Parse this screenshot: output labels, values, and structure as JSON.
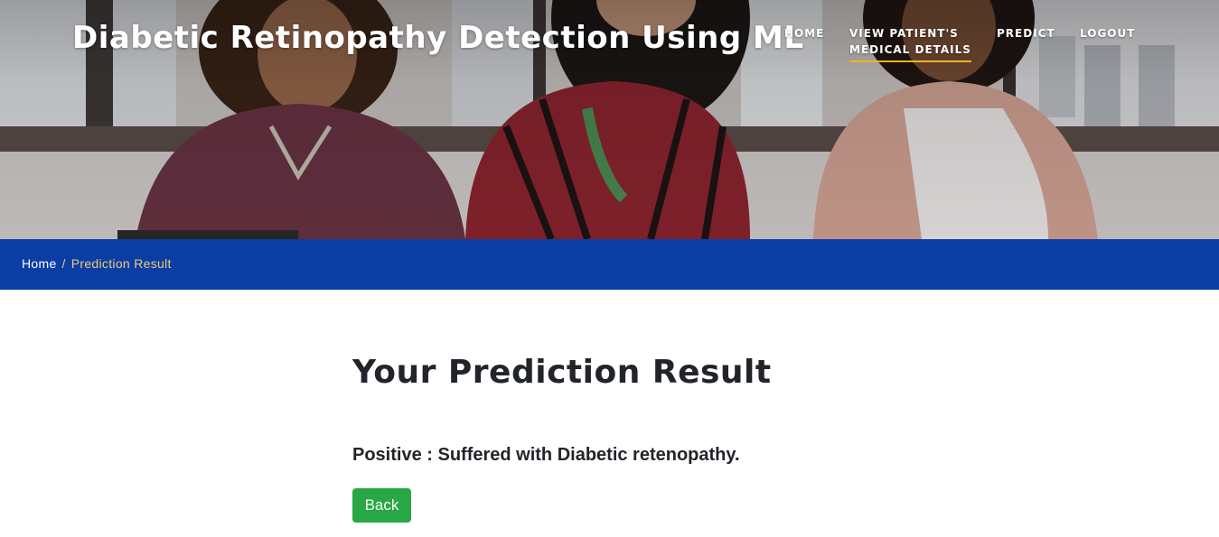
{
  "header": {
    "site_title": "Diabetic Retinopathy Detection Using ML",
    "nav": {
      "home": "HOME",
      "view_line1": "VIEW PATIENT'S",
      "view_line2": "MEDICAL DETAILS",
      "predict": "PREDICT",
      "logout": "LOGOUT"
    },
    "active_nav": "view",
    "accent_color": "#f3b31e"
  },
  "breadcrumb": {
    "home": "Home",
    "separator": "/",
    "current": "Prediction Result",
    "bar_color": "#0a3ea5"
  },
  "main": {
    "title": "Your Prediction Result",
    "result": "Positive : Suffered with Diabetic retenopathy.",
    "back_label": "Back",
    "button_color": "#28a745"
  }
}
